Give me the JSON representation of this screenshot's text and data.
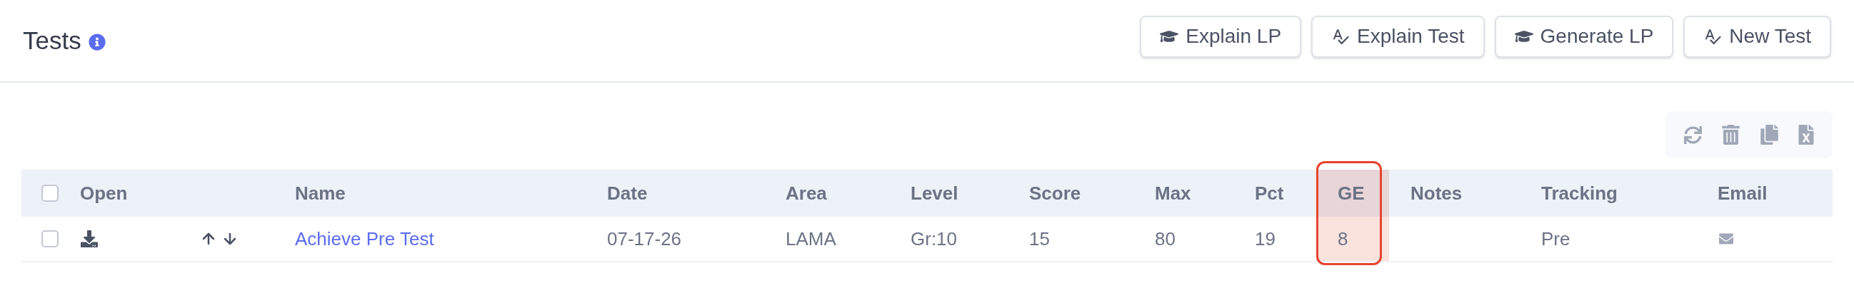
{
  "header": {
    "title": "Tests"
  },
  "buttons": [
    {
      "label": "Explain LP",
      "kind": "cap"
    },
    {
      "label": "Explain Test",
      "kind": "spellcheck"
    },
    {
      "label": "Generate LP",
      "kind": "cap"
    },
    {
      "label": "New Test",
      "kind": "spellcheck"
    }
  ],
  "table": {
    "select_all": {
      "checked": false
    },
    "columns": [
      {
        "kind": "label",
        "label": "Open",
        "highlighted": false
      },
      {
        "kind": "blank"
      },
      {
        "kind": "label",
        "label": "Name",
        "highlighted": false
      },
      {
        "kind": "label",
        "label": "Date",
        "highlighted": false
      },
      {
        "kind": "label",
        "label": "Area",
        "highlighted": false
      },
      {
        "kind": "label",
        "label": "Level",
        "highlighted": false
      },
      {
        "kind": "label",
        "label": "Score",
        "highlighted": false
      },
      {
        "kind": "label",
        "label": "Max",
        "highlighted": false
      },
      {
        "kind": "label",
        "label": "Pct",
        "highlighted": false
      },
      {
        "kind": "label",
        "label": "GE",
        "highlighted": true
      },
      {
        "kind": "label",
        "label": "Notes",
        "highlighted": false
      },
      {
        "kind": "label",
        "label": "Tracking",
        "highlighted": false
      },
      {
        "kind": "label",
        "label": "Email",
        "highlighted": false
      }
    ],
    "rows": [
      {
        "checked": false,
        "name": "Achieve Pre Test",
        "date": "07-17-26",
        "area": "LAMA",
        "level": "Gr:10",
        "score": "15",
        "max": "80",
        "pct": "19",
        "ge": "8",
        "tracking": "Pre"
      }
    ]
  }
}
